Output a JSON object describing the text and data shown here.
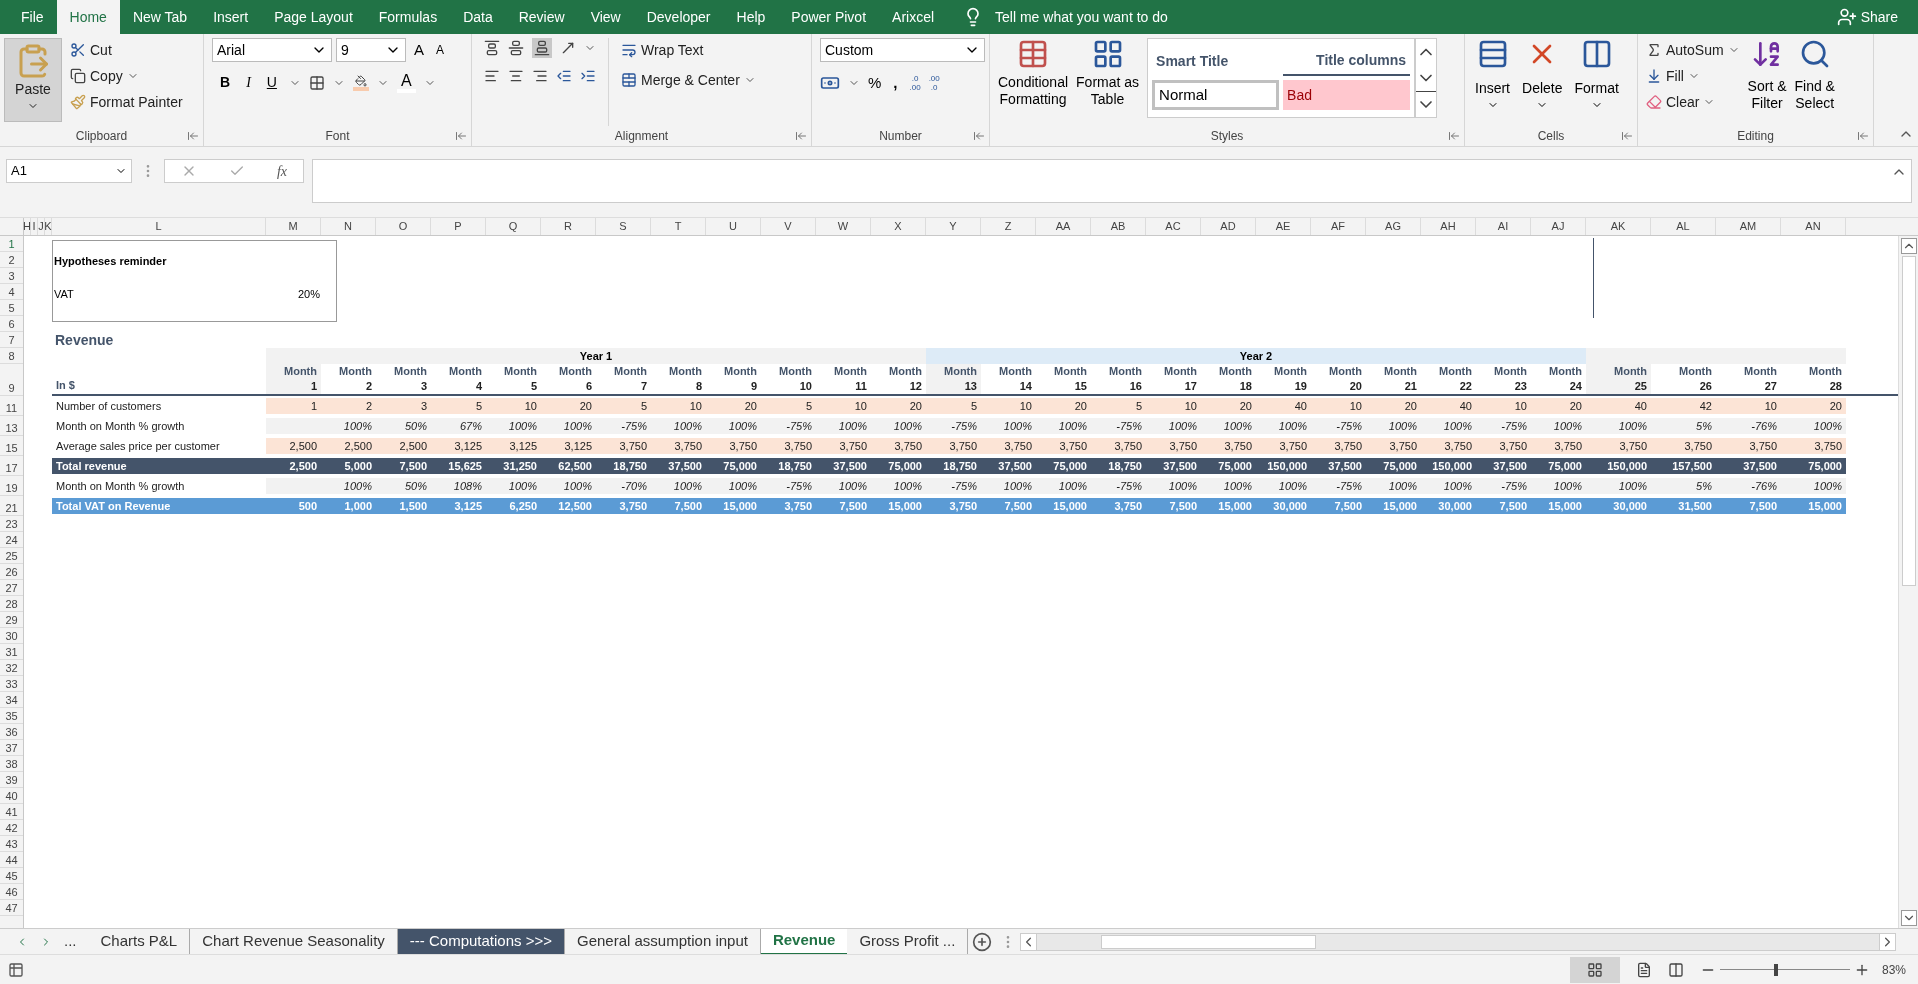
{
  "menu": [
    {
      "label": "File",
      "selected": false
    },
    {
      "label": "Home",
      "selected": true
    },
    {
      "label": "New Tab",
      "selected": false
    },
    {
      "label": "Insert",
      "selected": false
    },
    {
      "label": "Page Layout",
      "selected": false
    },
    {
      "label": "Formulas",
      "selected": false
    },
    {
      "label": "Data",
      "selected": false
    },
    {
      "label": "Review",
      "selected": false
    },
    {
      "label": "View",
      "selected": false
    },
    {
      "label": "Developer",
      "selected": false
    },
    {
      "label": "Help",
      "selected": false
    },
    {
      "label": "Power Pivot",
      "selected": false
    },
    {
      "label": "Arixcel",
      "selected": false
    }
  ],
  "tell_me": "Tell me what you want to do",
  "share": "Share",
  "ribbon": {
    "clipboard": {
      "label": "Clipboard",
      "paste": "Paste",
      "cut": "Cut",
      "copy": "Copy",
      "format_painter": "Format Painter"
    },
    "font": {
      "label": "Font",
      "font_name": "Arial",
      "font_size": "9",
      "grow": "A",
      "shrink": "A",
      "bold": "B",
      "italic": "I",
      "underline": "U",
      "font_color": "A"
    },
    "alignment": {
      "label": "Alignment",
      "wrap_text": "Wrap Text",
      "merge_center": "Merge & Center"
    },
    "number": {
      "label": "Number",
      "format": "Custom",
      "percent": "%",
      "comma": ",",
      "increase_decimal": [
        ".0",
        ".00"
      ],
      "decrease_decimal": [
        ".00",
        ".0"
      ]
    },
    "styles": {
      "label": "Styles",
      "conditional_formatting": [
        "Conditional",
        "Formatting"
      ],
      "format_as_table": [
        "Format as",
        "Table"
      ],
      "cell_styles": [
        {
          "label": "Smart Title",
          "kind": "title"
        },
        {
          "label": "Title columns",
          "kind": "heading"
        },
        {
          "label": "Normal",
          "kind": "normal"
        },
        {
          "label": "Bad",
          "kind": "bad"
        }
      ]
    },
    "cells": {
      "label": "Cells",
      "buttons": [
        {
          "label": "Insert",
          "kind": "insert"
        },
        {
          "label": "Delete",
          "kind": "delete"
        },
        {
          "label": "Format",
          "kind": "format"
        }
      ]
    },
    "editing": {
      "label": "Editing",
      "autosum": "AutoSum",
      "fill": "Fill",
      "clear": "Clear",
      "sort_filter": [
        "Sort &",
        "Filter"
      ],
      "find_select": [
        "Find &",
        "Select"
      ]
    }
  },
  "formula_bar": {
    "name_box": "A1",
    "fx": "fx"
  },
  "sheet": {
    "columns": [
      "H",
      "I",
      "J",
      "K",
      "L",
      "M",
      "N",
      "O",
      "P",
      "Q",
      "R",
      "S",
      "T",
      "U",
      "V",
      "W",
      "X",
      "Y",
      "Z",
      "AA",
      "AB",
      "AC",
      "AD",
      "AE",
      "AF",
      "AG",
      "AH",
      "AI",
      "AJ",
      "AK",
      "AL",
      "AM",
      "AN"
    ],
    "row_headers": [
      "1",
      "2",
      "3",
      "4",
      "5",
      "6",
      "7",
      "8",
      "9",
      "11",
      "13",
      "15",
      "17",
      "19",
      "21",
      "23",
      "24",
      "25",
      "26",
      "27",
      "28",
      "29",
      "30",
      "31",
      "32",
      "33",
      "34",
      "35",
      "36",
      "37",
      "38",
      "39",
      "40",
      "41",
      "42",
      "43",
      "44",
      "45",
      "46",
      "47"
    ],
    "hypotheses": {
      "title": "Hypotheses reminder",
      "label": "VAT",
      "value": "20%"
    },
    "section_title": "Revenue",
    "unit_label": "In $",
    "years": [
      {
        "label": "Year 1",
        "color": "#f2f2f2",
        "months": [
          {
            "label": "Month",
            "number": "1"
          },
          {
            "label": "Month",
            "number": "2"
          },
          {
            "label": "Month",
            "number": "3"
          },
          {
            "label": "Month",
            "number": "4"
          },
          {
            "label": "Month",
            "number": "5"
          },
          {
            "label": "Month",
            "number": "6"
          },
          {
            "label": "Month",
            "number": "7"
          },
          {
            "label": "Month",
            "number": "8"
          },
          {
            "label": "Month",
            "number": "9"
          },
          {
            "label": "Month",
            "number": "10"
          },
          {
            "label": "Month",
            "number": "11"
          },
          {
            "label": "Month",
            "number": "12"
          }
        ]
      },
      {
        "label": "Year 2",
        "color": "#ddebf7",
        "months": [
          {
            "label": "Month",
            "number": "13"
          },
          {
            "label": "Month",
            "number": "14"
          },
          {
            "label": "Month",
            "number": "15"
          },
          {
            "label": "Month",
            "number": "16"
          },
          {
            "label": "Month",
            "number": "17"
          },
          {
            "label": "Month",
            "number": "18"
          },
          {
            "label": "Month",
            "number": "19"
          },
          {
            "label": "Month",
            "number": "20"
          },
          {
            "label": "Month",
            "number": "21"
          },
          {
            "label": "Month",
            "number": "22"
          },
          {
            "label": "Month",
            "number": "23"
          },
          {
            "label": "Month",
            "number": "24"
          }
        ]
      },
      {
        "color": "#f2f2f2",
        "months": [
          {
            "label": "Month",
            "number": "25"
          },
          {
            "label": "Month",
            "number": "26"
          },
          {
            "label": "Month",
            "number": "27"
          },
          {
            "label": "Month",
            "number": "28"
          }
        ]
      }
    ],
    "rows": [
      {
        "label": "Number of customers",
        "kind": "input",
        "values": [
          "1",
          "2",
          "3",
          "5",
          "10",
          "20",
          "5",
          "10",
          "20",
          "5",
          "10",
          "20",
          "5",
          "10",
          "20",
          "5",
          "10",
          "20",
          "40",
          "10",
          "20",
          "40",
          "10",
          "20",
          "40",
          "42",
          "10",
          "20"
        ]
      },
      {
        "label": "Month on Month % growth",
        "kind": "growth",
        "values": [
          "100%",
          "50%",
          "67%",
          "100%",
          "100%",
          "-75%",
          "100%",
          "100%",
          "-75%",
          "100%",
          "100%",
          "-75%",
          "100%",
          "100%",
          "-75%",
          "100%",
          "100%",
          "100%",
          "-75%",
          "100%",
          "100%",
          "-75%",
          "100%",
          "100%",
          "5%",
          "-76%",
          "100%"
        ]
      },
      {
        "label": "Average sales price per customer",
        "kind": "input",
        "values": [
          "2,500",
          "2,500",
          "2,500",
          "3,125",
          "3,125",
          "3,125",
          "3,750",
          "3,750",
          "3,750",
          "3,750",
          "3,750",
          "3,750",
          "3,750",
          "3,750",
          "3,750",
          "3,750",
          "3,750",
          "3,750",
          "3,750",
          "3,750",
          "3,750",
          "3,750",
          "3,750",
          "3,750",
          "3,750",
          "3,750",
          "3,750",
          "3,750"
        ]
      },
      {
        "label": "Total revenue",
        "kind": "total",
        "values": [
          "2,500",
          "5,000",
          "7,500",
          "15,625",
          "31,250",
          "62,500",
          "18,750",
          "37,500",
          "75,000",
          "18,750",
          "37,500",
          "75,000",
          "18,750",
          "37,500",
          "75,000",
          "18,750",
          "37,500",
          "75,000",
          "150,000",
          "37,500",
          "75,000",
          "150,000",
          "37,500",
          "75,000",
          "150,000",
          "157,500",
          "37,500",
          "75,000"
        ]
      },
      {
        "label": "Month on Month % growth",
        "kind": "growth",
        "values": [
          "100%",
          "50%",
          "108%",
          "100%",
          "100%",
          "-70%",
          "100%",
          "100%",
          "-75%",
          "100%",
          "100%",
          "-75%",
          "100%",
          "100%",
          "-75%",
          "100%",
          "100%",
          "100%",
          "-75%",
          "100%",
          "100%",
          "-75%",
          "100%",
          "100%",
          "5%",
          "-76%",
          "100%"
        ]
      },
      {
        "label": "Total VAT on Revenue",
        "kind": "vat",
        "values": [
          "500",
          "1,000",
          "1,500",
          "3,125",
          "6,250",
          "12,500",
          "3,750",
          "7,500",
          "15,000",
          "3,750",
          "7,500",
          "15,000",
          "3,750",
          "7,500",
          "15,000",
          "3,750",
          "7,500",
          "15,000",
          "30,000",
          "7,500",
          "15,000",
          "30,000",
          "7,500",
          "15,000",
          "30,000",
          "31,500",
          "7,500",
          "15,000"
        ]
      }
    ]
  },
  "sheet_tabs": [
    {
      "label": "...",
      "kind": "more",
      "selected": false
    },
    {
      "label": "Charts P&L",
      "kind": "sheet",
      "selected": false
    },
    {
      "label": "Chart Revenue Seasonality",
      "kind": "sheet",
      "selected": false
    },
    {
      "label": "--- Computations >>>",
      "kind": "sheet",
      "selected": false,
      "color": "#44546a"
    },
    {
      "label": "General assumption input",
      "kind": "sheet",
      "selected": false
    },
    {
      "label": "Revenue",
      "kind": "sheet",
      "selected": true
    },
    {
      "label": "Gross Profit ...",
      "kind": "sheet",
      "selected": false
    }
  ],
  "zoom": {
    "label": "83%",
    "level": 0.43
  }
}
